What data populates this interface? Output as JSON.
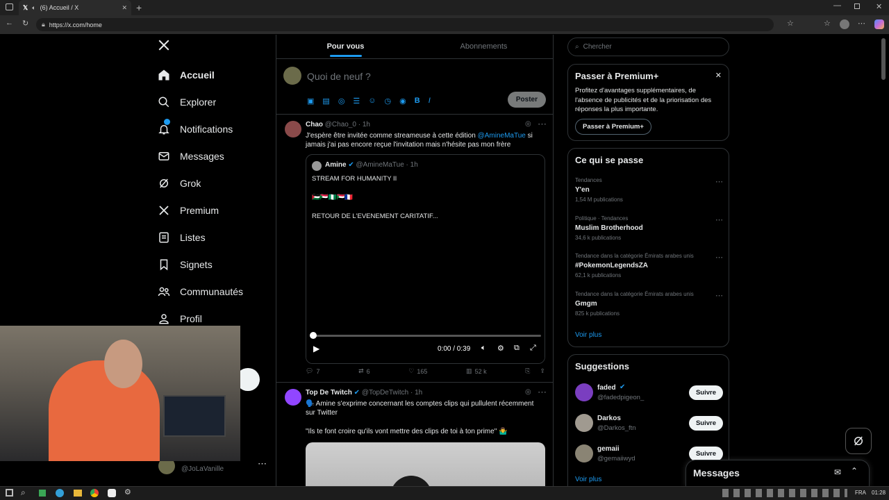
{
  "browser": {
    "tab_title": "(6) Accueil / X",
    "url": "https://x.com/home"
  },
  "nav": {
    "items": [
      {
        "label": "Accueil",
        "icon": "home-icon",
        "bold": true
      },
      {
        "label": "Explorer",
        "icon": "search-icon"
      },
      {
        "label": "Notifications",
        "icon": "bell-icon"
      },
      {
        "label": "Messages",
        "icon": "mail-icon"
      },
      {
        "label": "Grok",
        "icon": "grok-icon"
      },
      {
        "label": "Premium",
        "icon": "x-icon"
      },
      {
        "label": "Listes",
        "icon": "list-icon"
      },
      {
        "label": "Signets",
        "icon": "bookmark-icon"
      },
      {
        "label": "Communautés",
        "icon": "people-icon"
      },
      {
        "label": "Profil",
        "icon": "person-icon"
      }
    ],
    "account_handle": "@JoLaVanille"
  },
  "feed": {
    "tabs": [
      "Pour vous",
      "Abonnements"
    ],
    "compose_placeholder": "Quoi de neuf ?",
    "post_button": "Poster",
    "tweet1": {
      "name": "Chao",
      "handle": "@Chao_0",
      "time": "· 1h",
      "text_a": "J'espère être invitée comme streameuse à cette édition ",
      "mention": "@AmineMaTue",
      "text_b": " si jamais j'ai pas encore reçue l'invitation mais n'hésite pas mon frère",
      "quote": {
        "name": "Amine",
        "handle": "@AmineMaTue",
        "time": "· 1h",
        "line1": "STREAM FOR HUMANITY II",
        "line2": "🇵🇸🇸🇩🇳🇬🇸🇩🇫🇷",
        "line3": "RETOUR DE L'EVENEMENT CARITATIF..."
      },
      "video_time": "0:00 / 0:39",
      "video_progress": 0,
      "replies": "7",
      "reposts": "6",
      "likes": "165",
      "views": "52 k"
    },
    "tweet2": {
      "name": "Top De Twitch",
      "handle": "@TopDeTwitch",
      "time": "· 1h",
      "text1": "🗣️ Amine s'exprime concernant les comptes clips qui pullulent récemment sur Twitter",
      "text2": "\"Ils te font croire qu'ils vont mettre des clips de toi à ton prime\" 🤷‍♂️"
    }
  },
  "right": {
    "search_placeholder": "Chercher",
    "premium": {
      "title": "Passer à Premium+",
      "body": "Profitez d'avantages supplémentaires, de l'absence de publicités et de la priorisation des réponses la plus importante.",
      "button": "Passer à Premium+"
    },
    "trends": {
      "title": "Ce qui se passe",
      "items": [
        {
          "context": "Tendances",
          "name": "Y'en",
          "count": "1,54 M publications"
        },
        {
          "context": "Politique · Tendances",
          "name": "Muslim Brotherhood",
          "count": "34,6 k publications"
        },
        {
          "context": "Tendance dans la catégorie Émirats arabes unis",
          "name": "#PokemonLegendsZA",
          "count": "62,1 k publications"
        },
        {
          "context": "Tendance dans la catégorie Émirats arabes unis",
          "name": "Gmgm",
          "count": "825 k publications"
        }
      ],
      "show_more": "Voir plus"
    },
    "suggestions": {
      "title": "Suggestions",
      "items": [
        {
          "name": "faded",
          "handle": "@fadedpigeon_",
          "button": "Suivre"
        },
        {
          "name": "Darkos",
          "handle": "@Darkos_ftn",
          "button": "Suivre"
        },
        {
          "name": "gemaii",
          "handle": "@gemaiiwyd",
          "button": "Suivre"
        }
      ],
      "show_more": "Voir plus"
    },
    "messages_label": "Messages"
  },
  "taskbar": {
    "lang": "FRA",
    "time": "01:28"
  },
  "colors": {
    "accent": "#1d9bf0",
    "bg": "#000000",
    "border": "#2f3336"
  }
}
